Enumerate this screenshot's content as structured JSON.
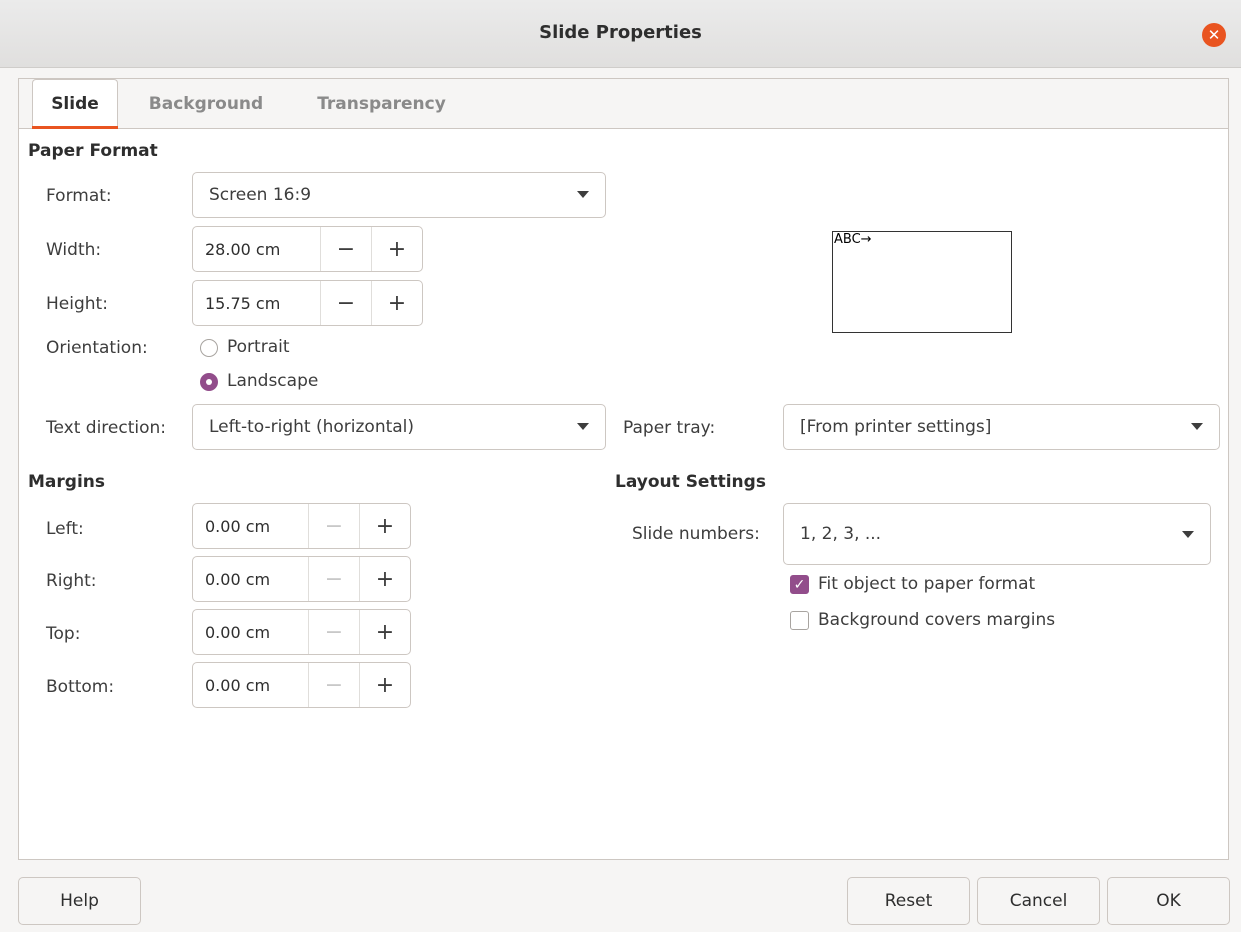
{
  "window": {
    "title": "Slide Properties",
    "close_icon": "✕"
  },
  "tabs": [
    {
      "label": "Slide",
      "active": true
    },
    {
      "label": "Background",
      "active": false
    },
    {
      "label": "Transparency",
      "active": false
    }
  ],
  "paper_format": {
    "heading": "Paper Format",
    "format_label": "Format:",
    "format_value": "Screen 16:9",
    "width_label": "Width:",
    "width_value": "28.00 cm",
    "height_label": "Height:",
    "height_value": "15.75 cm",
    "orientation_label": "Orientation:",
    "portrait_label": "Portrait",
    "landscape_label": "Landscape",
    "orientation_selected": "Landscape",
    "text_direction_label": "Text direction:",
    "text_direction_value": "Left-to-right (horizontal)",
    "paper_tray_label": "Paper tray:",
    "paper_tray_value": "[From printer settings]",
    "preview_text": "ABC→"
  },
  "spin_symbols": {
    "minus": "−",
    "plus": "+"
  },
  "margins": {
    "heading": "Margins",
    "left_label": "Left:",
    "left_value": "0.00 cm",
    "right_label": "Right:",
    "right_value": "0.00 cm",
    "top_label": "Top:",
    "top_value": "0.00 cm",
    "bottom_label": "Bottom:",
    "bottom_value": "0.00 cm"
  },
  "layout": {
    "heading": "Layout Settings",
    "slide_numbers_label": "Slide numbers:",
    "slide_numbers_value": "1, 2, 3, ...",
    "fit_object_label": "Fit object to paper format",
    "fit_object_checked": true,
    "bg_covers_label": "Background covers margins",
    "bg_covers_checked": false
  },
  "buttons": {
    "help": "Help",
    "reset": "Reset",
    "cancel": "Cancel",
    "ok": "OK"
  },
  "colors": {
    "accent": "#e95420",
    "check": "#924d8b"
  }
}
